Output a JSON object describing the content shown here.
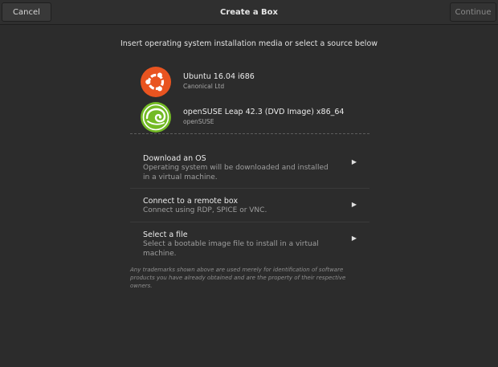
{
  "header": {
    "title": "Create a Box",
    "cancel_label": "Cancel",
    "continue_label": "Continue"
  },
  "instruction": "Insert operating system installation media or select a source below",
  "media": [
    {
      "name": "Ubuntu 16.04 i686",
      "vendor": "Canonical Ltd",
      "icon": "ubuntu-logo-icon",
      "color": "#e95420"
    },
    {
      "name": "openSUSE Leap 42.3 (DVD Image) x86_64",
      "vendor": "openSUSE",
      "icon": "opensuse-logo-icon",
      "color": "#73ba25"
    }
  ],
  "options": [
    {
      "title": "Download an OS",
      "description": "Operating system will be downloaded and installed in a virtual machine.",
      "icon": "arrow-right-icon"
    },
    {
      "title": "Connect to a remote box",
      "description": "Connect using RDP, SPICE or VNC.",
      "icon": "arrow-right-icon"
    },
    {
      "title": "Select a file",
      "description": "Select a bootable image file to install in a virtual machine.",
      "icon": "arrow-right-icon"
    }
  ],
  "disclaimer": "Any trademarks shown above are used merely for identification of software products you have already obtained and are the property of their respective owners.",
  "colors": {
    "background": "#2c2c2c",
    "ubuntu": "#e95420",
    "opensuse": "#73ba25"
  }
}
